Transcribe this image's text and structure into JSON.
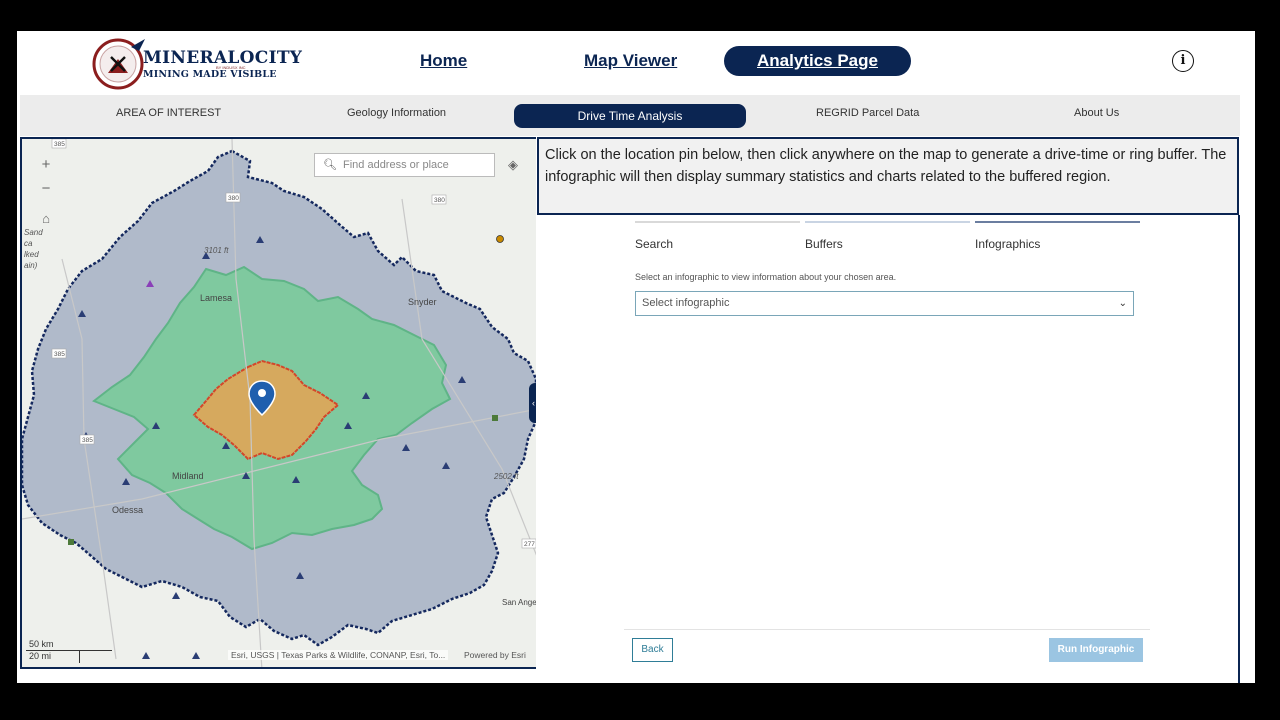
{
  "header": {
    "logo_title": "MINERALOCITY",
    "logo_tagline": "MINING MADE VISIBLE",
    "logo_small": "BY INDUSX INC",
    "nav": [
      {
        "label": "Home"
      },
      {
        "label": "Map Viewer"
      },
      {
        "label": "Analytics Page"
      }
    ],
    "info_icon": "info-icon",
    "info_glyph": "i"
  },
  "tabs": [
    {
      "label": "AREA OF INTEREST"
    },
    {
      "label": "Geology Information"
    },
    {
      "label": "Drive Time Analysis",
      "active": true
    },
    {
      "label": "REGRID Parcel Data"
    },
    {
      "label": "About Us"
    }
  ],
  "map": {
    "search_placeholder": "Find address or place",
    "zoom_in": "+",
    "zoom_out": "−",
    "scale_km": "50 km",
    "scale_mi": "20 mi",
    "attribution": "Esri, USGS | Texas Parks & Wildlife, CONANP, Esri, To...",
    "powered_by": "Powered by Esri",
    "places": {
      "lamesa": "Lamesa",
      "snyder": "Snyder",
      "midland": "Midland",
      "odessa": "Odessa",
      "san_angelo": "San Ange",
      "elev_1": "3101 ft",
      "elev_2": "2502 ft",
      "left_edge": "Sand\nca\nlked\nain)"
    },
    "roads": {
      "r385a": "385",
      "r380": "380",
      "r380b": "380",
      "r385b": "385",
      "r385c": "385",
      "r277": "277"
    },
    "colors": {
      "outer_buffer": "#a9b4c7",
      "outer_outline": "#14285e",
      "mid_buffer": "#7cc99c",
      "inner_buffer": "#d6a95e",
      "inner_outline": "#d4462a",
      "pin": "#1f5fae"
    }
  },
  "panel": {
    "instructions": "Click on the location pin below, then click anywhere on the map to generate a drive-time or ring buffer. The infographic will then display summary statistics and charts related to the buffered region.",
    "steps": [
      {
        "label": "Search"
      },
      {
        "label": "Buffers"
      },
      {
        "label": "Infographics",
        "active": true
      }
    ],
    "hint": "Select an infographic to view information about your chosen area.",
    "select_placeholder": "Select infographic",
    "back": "Back",
    "run": "Run Infographic"
  }
}
